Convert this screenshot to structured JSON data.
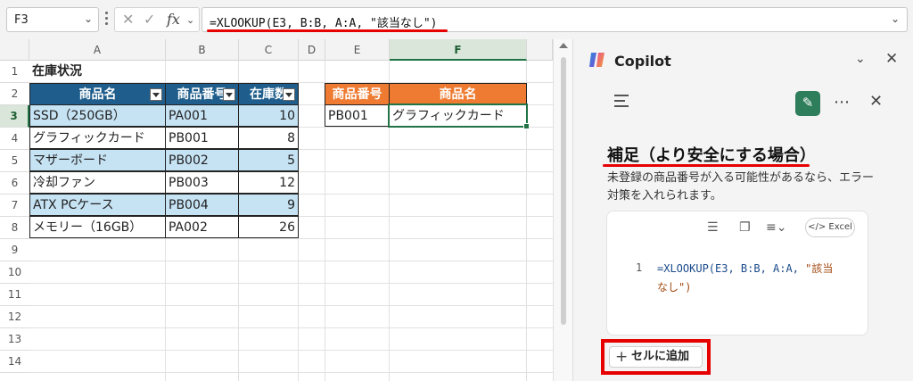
{
  "formula_bar": {
    "name_box": "F3",
    "formula": "=XLOOKUP(E3, B:B, A:A, \"該当なし\")",
    "icons": {
      "cancel": "x-icon",
      "enter": "checkmark-icon",
      "function": "fx-icon"
    }
  },
  "grid": {
    "column_headers": [
      "A",
      "B",
      "C",
      "D",
      "E",
      "F"
    ],
    "selected_column": "F",
    "row_headers": [
      "1",
      "2",
      "3",
      "4",
      "5",
      "6",
      "7",
      "8",
      "9",
      "10",
      "11",
      "12",
      "13",
      "14"
    ],
    "selected_row": "3",
    "title": "在庫状況",
    "table1": {
      "headers": [
        "商品名",
        "商品番号",
        "在庫数"
      ],
      "rows": [
        [
          "SSD（250GB）",
          "PA001",
          "10"
        ],
        [
          "グラフィックカード",
          "PB001",
          "8"
        ],
        [
          "マザーボード",
          "PB002",
          "5"
        ],
        [
          "冷却ファン",
          "PB003",
          "12"
        ],
        [
          "ATX PCケース",
          "PB004",
          "9"
        ],
        [
          "メモリー（16GB）",
          "PA002",
          "26"
        ]
      ]
    },
    "table2": {
      "headers": [
        "商品番号",
        "商品名"
      ],
      "row": [
        "PB001",
        "グラフィックカード"
      ]
    },
    "colors": {
      "table1_header": "#1f5e8c",
      "table2_header": "#ee7b31",
      "band": "#c6e3f4",
      "selection": "#217346"
    }
  },
  "copilot": {
    "title": "Copilot",
    "heading": "補足（より安全にする場合）",
    "body": "未登録の商品番号が入る可能性があるなら、エラー対策を入れられます。",
    "code": {
      "line_number": "1",
      "prefix": "=XLOOKUP(E3, B:B, A:A, ",
      "string_part1": "\"該当",
      "string_part2": "なし\")",
      "badge": "Excel"
    },
    "add_cell_label": "セルに追加",
    "colors": {
      "new_chat": "#2e7d5b",
      "highlight": "#e60000"
    }
  }
}
